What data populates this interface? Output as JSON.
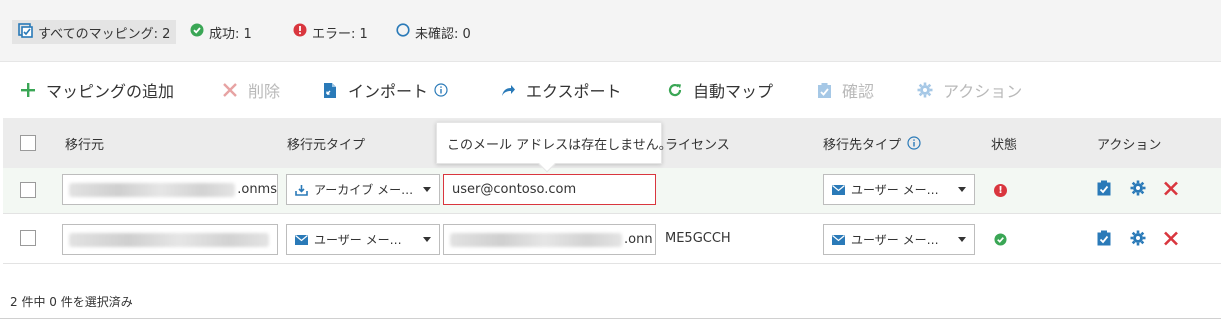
{
  "filters": {
    "all": "すべてのマッピング: 2",
    "success": "成功: 1",
    "error": "エラー: 1",
    "unverified": "未確認: 0"
  },
  "toolbar": {
    "add": "マッピングの追加",
    "delete": "削除",
    "import": "インポート",
    "export": "エクスポート",
    "automap": "自動マップ",
    "verify": "確認",
    "actions": "アクション"
  },
  "table": {
    "headers": {
      "source": "移行元",
      "source_type": "移行元タイプ",
      "license": "ライセンス",
      "target_type": "移行先タイプ",
      "status": "状態",
      "actions": "アクション"
    },
    "rows": [
      {
        "source_suffix": ".onms",
        "source_type": "アーカイブ メー…",
        "target": "user@contoso.com",
        "license": "",
        "target_type": "ユーザー メー…",
        "status": "error"
      },
      {
        "source_suffix": "",
        "source_type": "ユーザー メー…",
        "target_suffix": ".onn",
        "license": "ME5GCCH",
        "target_type": "ユーザー メー…",
        "status": "success"
      }
    ]
  },
  "tooltip": "このメール アドレスは存在しません。",
  "footer": "2 件中 0 件を選択済み",
  "colors": {
    "accent": "#2a7ab8",
    "success": "#3aa655",
    "error": "#d9363e",
    "disabled": "#b9b9b9"
  }
}
